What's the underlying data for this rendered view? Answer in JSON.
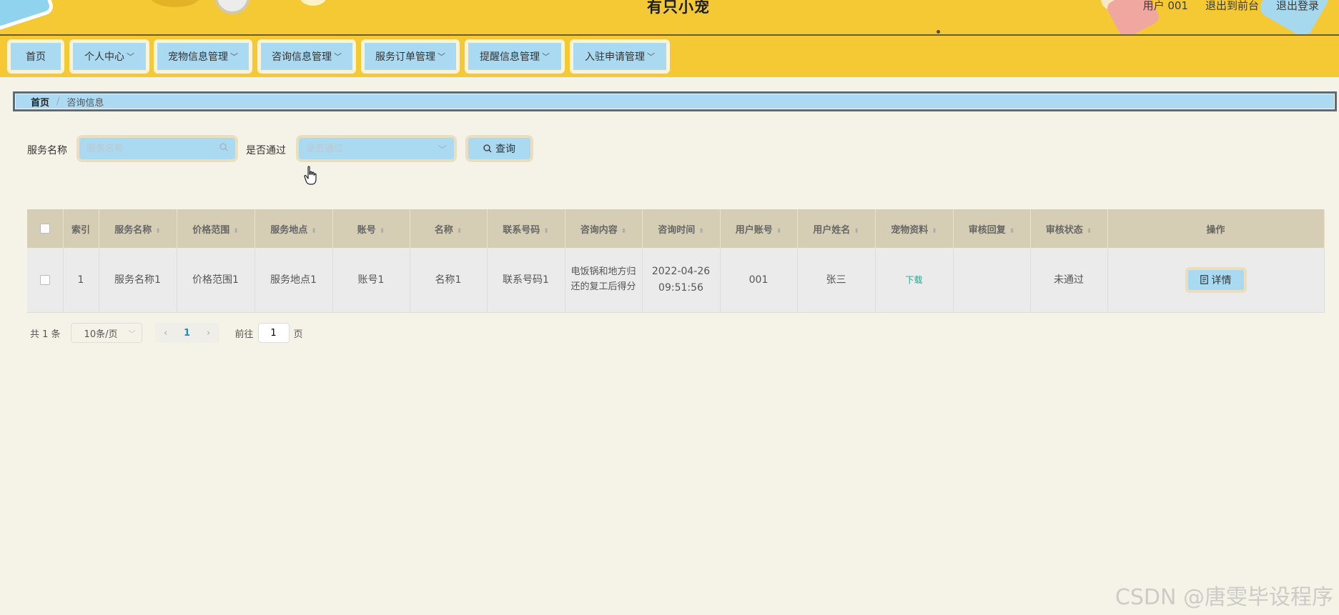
{
  "header": {
    "title": "有只小宠",
    "user_label": "用户 001",
    "front_link": "退出到前台",
    "logout_link": "退出登录"
  },
  "nav": [
    {
      "label": "首页",
      "has_dropdown": false
    },
    {
      "label": "个人中心",
      "has_dropdown": true
    },
    {
      "label": "宠物信息管理",
      "has_dropdown": true
    },
    {
      "label": "咨询信息管理",
      "has_dropdown": true
    },
    {
      "label": "服务订单管理",
      "has_dropdown": true
    },
    {
      "label": "提醒信息管理",
      "has_dropdown": true
    },
    {
      "label": "入驻申请管理",
      "has_dropdown": true
    }
  ],
  "breadcrumb": {
    "home": "首页",
    "separator": "/",
    "current": "咨询信息"
  },
  "search": {
    "name_label": "服务名称",
    "name_placeholder": "服务名称",
    "pass_label": "是否通过",
    "pass_placeholder": "是否通过",
    "query_label": "查询"
  },
  "table": {
    "headers": [
      "索引",
      "服务名称",
      "价格范围",
      "服务地点",
      "账号",
      "名称",
      "联系号码",
      "咨询内容",
      "咨询时间",
      "用户账号",
      "用户姓名",
      "宠物资料",
      "审核回复",
      "审核状态",
      "操作"
    ],
    "rows": [
      {
        "index": "1",
        "service_name": "服务名称1",
        "price_range": "价格范围1",
        "service_location": "服务地点1",
        "account": "账号1",
        "name": "名称1",
        "phone": "联系号码1",
        "content": "电饭锅和地方归还的复工后得分",
        "time_date": "2022-04-26",
        "time_clock": "09:51:56",
        "user_account": "001",
        "user_name": "张三",
        "pet_file": "下载",
        "review_reply": "",
        "review_status": "未通过",
        "action": "详情"
      }
    ]
  },
  "pagination": {
    "total_text": "共 1 条",
    "page_size": "10条/页",
    "current_page": "1",
    "goto_prefix": "前往",
    "goto_value": "1",
    "goto_suffix": "页"
  },
  "watermark": "CSDN @唐雯毕设程序",
  "colors": {
    "header_bg": "#f5c934",
    "accent_blue": "#a9daf2",
    "page_bg": "#f5f2e7",
    "table_header_bg": "#d6ceb4",
    "link_green": "#2aa58d"
  }
}
